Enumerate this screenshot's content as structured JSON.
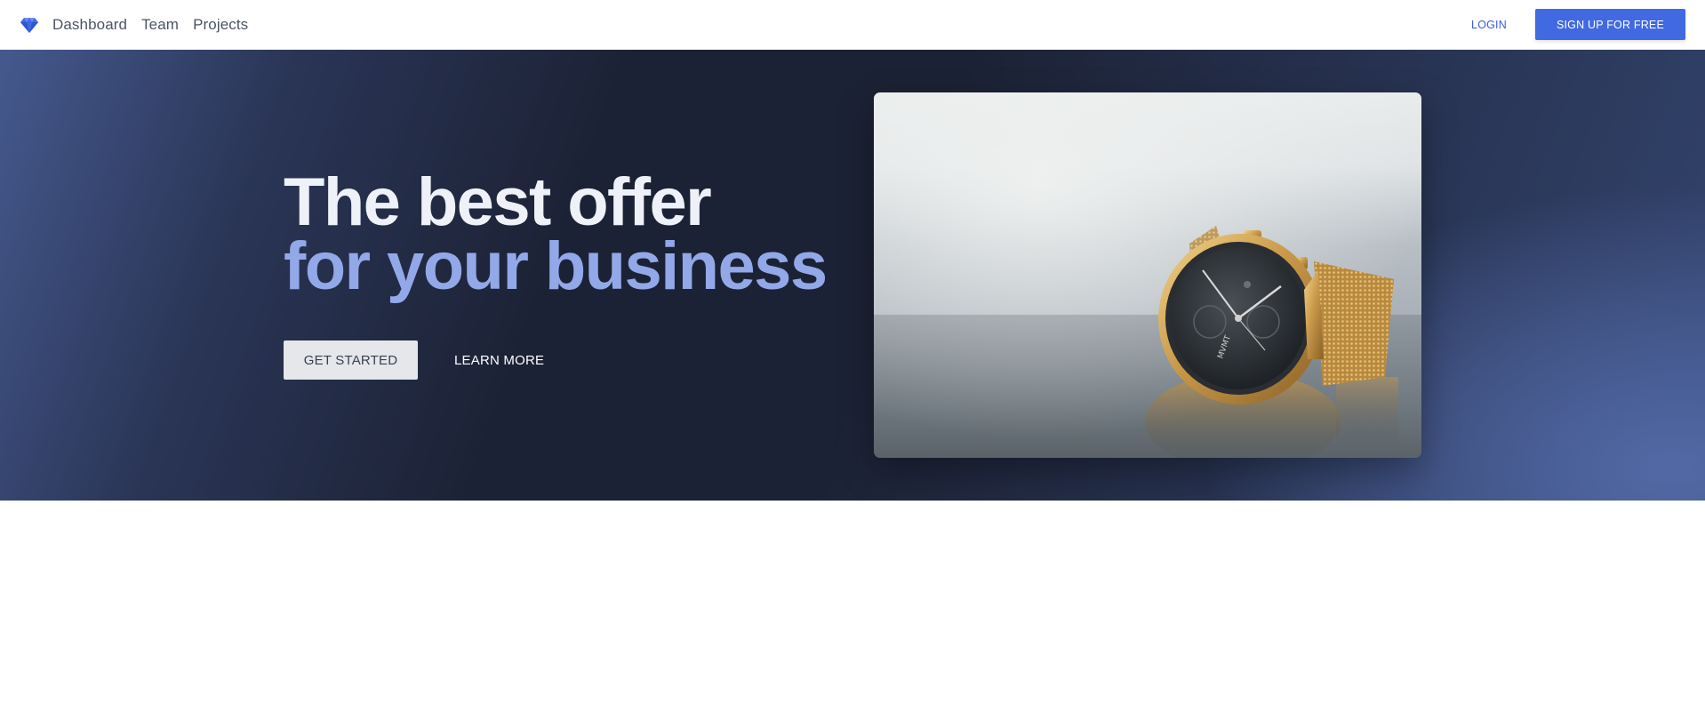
{
  "nav": {
    "logo_icon": "diamond-icon",
    "links": [
      {
        "label": "Dashboard"
      },
      {
        "label": "Team"
      },
      {
        "label": "Projects"
      }
    ],
    "login_label": "LOGIN",
    "signup_label": "SIGN UP FOR FREE"
  },
  "hero": {
    "headline_line1": "The best offer",
    "headline_line2": "for your business",
    "primary_cta": "GET STARTED",
    "secondary_cta": "LEARN MORE",
    "image_subject": "gold-wristwatch-photo",
    "watch_brand": "MVMT"
  },
  "colors": {
    "accent": "#4169e1",
    "login_text": "#3b5bdb",
    "headline_primary": "#eef1f7",
    "headline_accent": "#93a8e8",
    "hero_bg_dark": "#1c2235",
    "hero_bg_light": "#5269a6"
  }
}
